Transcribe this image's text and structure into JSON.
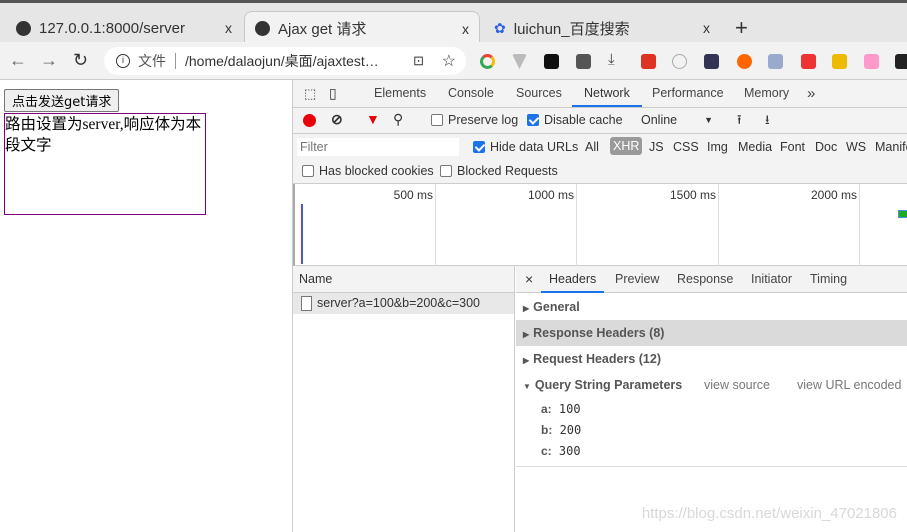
{
  "browser": {
    "tabs": [
      {
        "title": "127.0.0.1:8000/server",
        "icon": "globe-icon"
      },
      {
        "title": "Ajax get 请求",
        "icon": "globe-icon",
        "active": true
      },
      {
        "title": "luichun_百度搜索",
        "icon": "baidu-paw-icon"
      }
    ],
    "new_tab": "+",
    "close": "x",
    "address": {
      "security_label": "文件",
      "url": "/home/dalaojun/桌面/ajaxtest…"
    }
  },
  "page": {
    "button": "点击发送get请求",
    "result_text": "路由设置为server,响应体为本段文字"
  },
  "devtools": {
    "tabs": [
      "Elements",
      "Console",
      "Sources",
      "Network",
      "Performance",
      "Memory"
    ],
    "active_tab": "Network",
    "more": "»",
    "toolbar": {
      "preserve_log": "Preserve log",
      "preserve_log_checked": false,
      "disable_cache": "Disable cache",
      "disable_cache_checked": true,
      "throttle": "Online"
    },
    "filter": {
      "placeholder": "Filter",
      "hide_data_urls": "Hide data URLs",
      "hide_data_urls_checked": true,
      "types": [
        "All",
        "XHR",
        "JS",
        "CSS",
        "Img",
        "Media",
        "Font",
        "Doc",
        "WS",
        "Manife"
      ],
      "active_type": "XHR",
      "has_blocked_cookies": "Has blocked cookies",
      "blocked_requests": "Blocked Requests"
    },
    "timeline": {
      "ticks": [
        "500 ms",
        "1000 ms",
        "1500 ms",
        "2000 ms"
      ]
    },
    "requests": {
      "header": "Name",
      "items": [
        "server?a=100&b=200&c=300"
      ]
    },
    "details": {
      "close": "×",
      "tabs": [
        "Headers",
        "Preview",
        "Response",
        "Initiator",
        "Timing"
      ],
      "active_tab": "Headers",
      "sections": [
        "General",
        "Response Headers (8)",
        "Request Headers (12)"
      ],
      "query": {
        "title": "Query String Parameters",
        "view_source": "view source",
        "view_encoded": "view URL encoded",
        "params": [
          {
            "k": "a:",
            "v": "100"
          },
          {
            "k": "b:",
            "v": "200"
          },
          {
            "k": "c:",
            "v": "300"
          }
        ]
      }
    }
  },
  "watermark": "https://blog.csdn.net/weixin_47021806",
  "colors": {
    "accent": "#1a73e8",
    "record": "#e8000b",
    "result_border": "#800080"
  }
}
